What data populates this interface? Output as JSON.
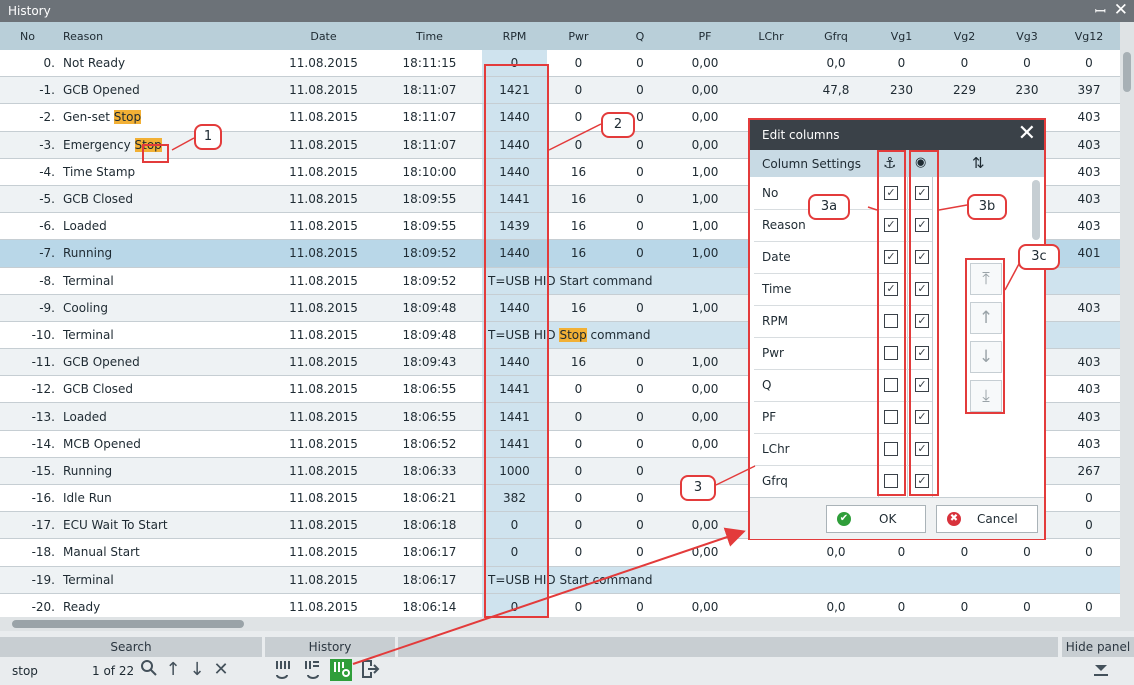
{
  "window": {
    "title": "History",
    "pin_glyph": "ꟷ",
    "close_glyph": "✕"
  },
  "columns": [
    "No",
    "Reason",
    "Date",
    "Time",
    "RPM",
    "Pwr",
    "Q",
    "PF",
    "LChr",
    "Gfrq",
    "Vg1",
    "Vg2",
    "Vg3",
    "Vg12"
  ],
  "rows": [
    {
      "no": "0.",
      "reason": "Not Ready",
      "date": "11.08.2015",
      "time": "18:11:15",
      "rpm": "0",
      "pwr": "0",
      "q": "0",
      "pf": "0,00",
      "lchr": "",
      "gfrq": "0,0",
      "vg1": "0",
      "vg2": "0",
      "vg3": "0",
      "vg12": "0"
    },
    {
      "no": "-1.",
      "reason": "GCB Opened",
      "date": "11.08.2015",
      "time": "18:11:07",
      "rpm": "1421",
      "pwr": "0",
      "q": "0",
      "pf": "0,00",
      "lchr": "",
      "gfrq": "47,8",
      "vg1": "230",
      "vg2": "229",
      "vg3": "230",
      "vg12": "397"
    },
    {
      "no": "-2.",
      "reason": "Gen-set ",
      "reason_hl": "Stop",
      "date": "11.08.2015",
      "time": "18:11:07",
      "rpm": "1440",
      "pwr": "0",
      "q": "0",
      "pf": "0,00",
      "lchr": "",
      "gfrq": "",
      "vg1": "",
      "vg2": "",
      "vg3": "",
      "vg12": "403"
    },
    {
      "no": "-3.",
      "reason": "Emergency ",
      "reason_hl": "Stop",
      "date": "11.08.2015",
      "time": "18:11:07",
      "rpm": "1440",
      "pwr": "0",
      "q": "0",
      "pf": "0,00",
      "lchr": "",
      "gfrq": "",
      "vg1": "",
      "vg2": "",
      "vg3": "",
      "vg12": "403"
    },
    {
      "no": "-4.",
      "reason": "Time Stamp",
      "date": "11.08.2015",
      "time": "18:10:00",
      "rpm": "1440",
      "pwr": "16",
      "q": "0",
      "pf": "1,00",
      "lchr": "",
      "gfrq": "",
      "vg1": "",
      "vg2": "",
      "vg3": "",
      "vg12": "403"
    },
    {
      "no": "-5.",
      "reason": "GCB Closed",
      "date": "11.08.2015",
      "time": "18:09:55",
      "rpm": "1441",
      "pwr": "16",
      "q": "0",
      "pf": "1,00",
      "lchr": "",
      "gfrq": "",
      "vg1": "",
      "vg2": "",
      "vg3": "",
      "vg12": "403"
    },
    {
      "no": "-6.",
      "reason": "Loaded",
      "date": "11.08.2015",
      "time": "18:09:55",
      "rpm": "1439",
      "pwr": "16",
      "q": "0",
      "pf": "1,00",
      "lchr": "",
      "gfrq": "",
      "vg1": "",
      "vg2": "",
      "vg3": "",
      "vg12": "403"
    },
    {
      "no": "-7.",
      "reason": "Running",
      "date": "11.08.2015",
      "time": "18:09:52",
      "rpm": "1440",
      "pwr": "16",
      "q": "0",
      "pf": "1,00",
      "lchr": "",
      "gfrq": "",
      "vg1": "",
      "vg2": "",
      "vg3": "",
      "vg12": "401"
    },
    {
      "no": "-8.",
      "reason": "Terminal",
      "date": "11.08.2015",
      "time": "18:09:52",
      "cmd": "T=USB HID Start command"
    },
    {
      "no": "-9.",
      "reason": "Cooling",
      "date": "11.08.2015",
      "time": "18:09:48",
      "rpm": "1440",
      "pwr": "16",
      "q": "0",
      "pf": "1,00",
      "lchr": "",
      "gfrq": "",
      "vg1": "",
      "vg2": "",
      "vg3": "",
      "vg12": "403"
    },
    {
      "no": "-10.",
      "reason": "Terminal",
      "date": "11.08.2015",
      "time": "18:09:48",
      "cmd_pre": "T=USB HID ",
      "cmd_hl": "Stop",
      "cmd_post": " command"
    },
    {
      "no": "-11.",
      "reason": "GCB Opened",
      "date": "11.08.2015",
      "time": "18:09:43",
      "rpm": "1440",
      "pwr": "16",
      "q": "0",
      "pf": "1,00",
      "lchr": "",
      "gfrq": "",
      "vg1": "",
      "vg2": "",
      "vg3": "",
      "vg12": "403"
    },
    {
      "no": "-12.",
      "reason": "GCB Closed",
      "date": "11.08.2015",
      "time": "18:06:55",
      "rpm": "1441",
      "pwr": "0",
      "q": "0",
      "pf": "0,00",
      "lchr": "",
      "gfrq": "",
      "vg1": "",
      "vg2": "",
      "vg3": "",
      "vg12": "403"
    },
    {
      "no": "-13.",
      "reason": "Loaded",
      "date": "11.08.2015",
      "time": "18:06:55",
      "rpm": "1441",
      "pwr": "0",
      "q": "0",
      "pf": "0,00",
      "lchr": "",
      "gfrq": "",
      "vg1": "",
      "vg2": "",
      "vg3": "",
      "vg12": "403"
    },
    {
      "no": "-14.",
      "reason": "MCB Opened",
      "date": "11.08.2015",
      "time": "18:06:52",
      "rpm": "1441",
      "pwr": "0",
      "q": "0",
      "pf": "0,00",
      "lchr": "",
      "gfrq": "",
      "vg1": "",
      "vg2": "",
      "vg3": "",
      "vg12": "403"
    },
    {
      "no": "-15.",
      "reason": "Running",
      "date": "11.08.2015",
      "time": "18:06:33",
      "rpm": "1000",
      "pwr": "0",
      "q": "0",
      "pf": "",
      "lchr": "",
      "gfrq": "",
      "vg1": "",
      "vg2": "",
      "vg3": "",
      "vg12": "267"
    },
    {
      "no": "-16.",
      "reason": "Idle Run",
      "date": "11.08.2015",
      "time": "18:06:21",
      "rpm": "382",
      "pwr": "0",
      "q": "0",
      "pf": "",
      "lchr": "",
      "gfrq": "",
      "vg1": "",
      "vg2": "",
      "vg3": "",
      "vg12": "0"
    },
    {
      "no": "-17.",
      "reason": "ECU Wait To Start",
      "date": "11.08.2015",
      "time": "18:06:18",
      "rpm": "0",
      "pwr": "0",
      "q": "0",
      "pf": "0,00",
      "lchr": "",
      "gfrq": "",
      "vg1": "",
      "vg2": "",
      "vg3": "",
      "vg12": "0"
    },
    {
      "no": "-18.",
      "reason": "Manual Start",
      "date": "11.08.2015",
      "time": "18:06:17",
      "rpm": "0",
      "pwr": "0",
      "q": "0",
      "pf": "0,00",
      "lchr": "",
      "gfrq": "0,0",
      "vg1": "0",
      "vg2": "0",
      "vg3": "0",
      "vg12": "0"
    },
    {
      "no": "-19.",
      "reason": "Terminal",
      "date": "11.08.2015",
      "time": "18:06:17",
      "cmd": "T=USB HID Start command"
    },
    {
      "no": "-20.",
      "reason": "Ready",
      "date": "11.08.2015",
      "time": "18:06:14",
      "rpm": "0",
      "pwr": "0",
      "q": "0",
      "pf": "0,00",
      "lchr": "",
      "gfrq": "0,0",
      "vg1": "0",
      "vg2": "0",
      "vg3": "0",
      "vg12": "0"
    }
  ],
  "selected_row": 7,
  "bottom": {
    "search_label": "Search",
    "history_label": "History",
    "hide_panel_label": "Hide panel",
    "search_value": "stop",
    "search_count": "1 of 22",
    "search_icon": "search-icon",
    "up_glyph": "↑",
    "down_glyph": "↓",
    "clear_glyph": "✕"
  },
  "dialog": {
    "title": "Edit columns",
    "close_glyph": "✕",
    "column_settings": "Column Settings",
    "anchor_glyph": "⚓",
    "eye_glyph": "◉",
    "sort_glyph": "⇅",
    "check_glyph": "✓",
    "items": [
      {
        "name": "No",
        "anchored": true,
        "visible": true
      },
      {
        "name": "Reason",
        "anchored": true,
        "visible": true
      },
      {
        "name": "Date",
        "anchored": true,
        "visible": true
      },
      {
        "name": "Time",
        "anchored": true,
        "visible": true
      },
      {
        "name": "RPM",
        "anchored": false,
        "visible": true
      },
      {
        "name": "Pwr",
        "anchored": false,
        "visible": true
      },
      {
        "name": "Q",
        "anchored": false,
        "visible": true
      },
      {
        "name": "PF",
        "anchored": false,
        "visible": true
      },
      {
        "name": "LChr",
        "anchored": false,
        "visible": true
      },
      {
        "name": "Gfrq",
        "anchored": false,
        "visible": true
      }
    ],
    "order_buttons": [
      "⤒",
      "↑",
      "↓",
      "⤓"
    ],
    "ok_label": "OK",
    "cancel_label": "Cancel",
    "ok_glyph": "✔",
    "cancel_glyph": "✖"
  },
  "callouts": [
    "1",
    "2",
    "3",
    "3a",
    "3b",
    "3c"
  ],
  "colors": {
    "highlight": "#f2b035",
    "annotation_red": "#e33b3b",
    "header": "#b9cfd9",
    "title_dark": "#3a4148"
  }
}
